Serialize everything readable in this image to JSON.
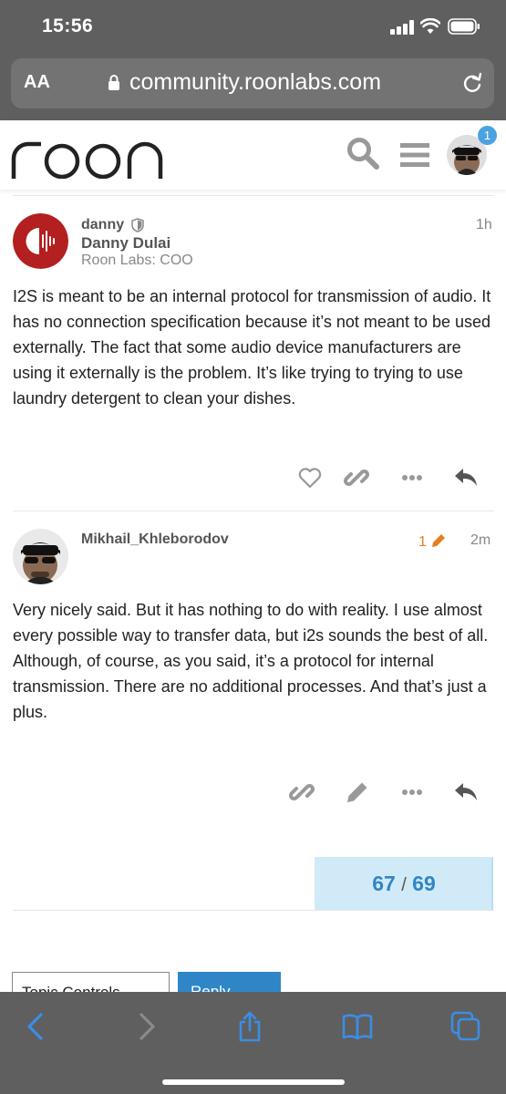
{
  "status_bar": {
    "time": "15:56"
  },
  "browser": {
    "text_size_label": "AA",
    "url": "community.roonlabs.com"
  },
  "header": {
    "logo_text": "roon",
    "notification_count": "1"
  },
  "posts": [
    {
      "username": "danny",
      "full_name": "Danny Dulai",
      "user_title": "Roon Labs: COO",
      "time": "1h",
      "body": "I2S is meant to be an internal protocol for transmission of audio. It has no connection specification because it’s not meant to be used externally. The fact that some audio device manufacturers are using it externally is the problem. It’s like trying to trying to use laundry detergent to clean your dishes."
    },
    {
      "username": "Mikhail_Khleborodov",
      "time": "2m",
      "edit_count": "1",
      "body_lines": [
        "Very nicely said. But it has nothing to do with reality. I use almost every possible way to transfer data, but i2s sounds the best of all.",
        "Although, of course, as you said, it’s a protocol for internal transmission. There are no additional processes. And that’s just a plus."
      ]
    }
  ],
  "timeline": {
    "current": "67",
    "separator": "/",
    "total": "69"
  },
  "bottom_controls": {
    "topic_controls_label": "Topic Controls",
    "reply_label": "Reply"
  },
  "colors": {
    "accent": "#2f86c6",
    "timeline_bg": "#d1eaf8",
    "edit": "#e67e22",
    "avatar_red": "#b3201f",
    "browser_chrome": "#5f5f5f",
    "badge": "#4aa3e0"
  }
}
